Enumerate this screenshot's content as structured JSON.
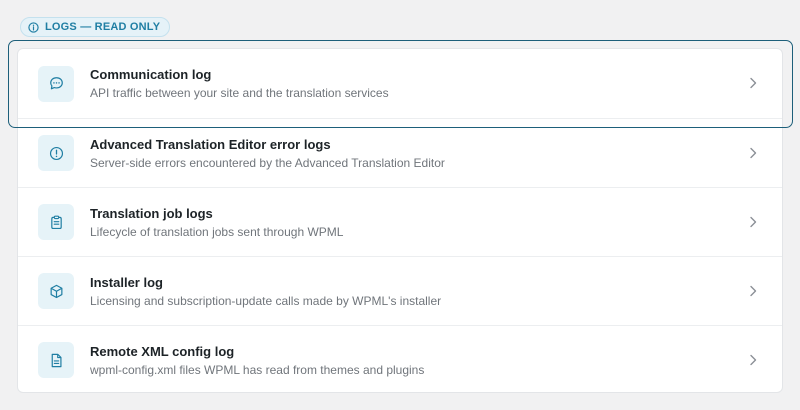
{
  "badge": {
    "label": "LOGS — READ ONLY",
    "icon": "info-icon"
  },
  "accent_color": "#1f7ea3",
  "logs": [
    {
      "title": "Communication log",
      "subtitle": "API traffic between your site and the translation services",
      "icon": "chat-bubble-icon",
      "focused": true
    },
    {
      "title": "Advanced Translation Editor error logs",
      "subtitle": "Server-side errors encountered by the Advanced Translation Editor",
      "icon": "alert-circle-icon"
    },
    {
      "title": "Translation job logs",
      "subtitle": "Lifecycle of translation jobs sent through WPML",
      "icon": "clipboard-icon"
    },
    {
      "title": "Installer log",
      "subtitle": "Licensing and subscription-update calls made by WPML's installer",
      "icon": "package-box-icon"
    },
    {
      "title": "Remote XML config log",
      "subtitle": "wpml-config.xml files WPML has read from themes and plugins",
      "icon": "document-icon"
    }
  ]
}
